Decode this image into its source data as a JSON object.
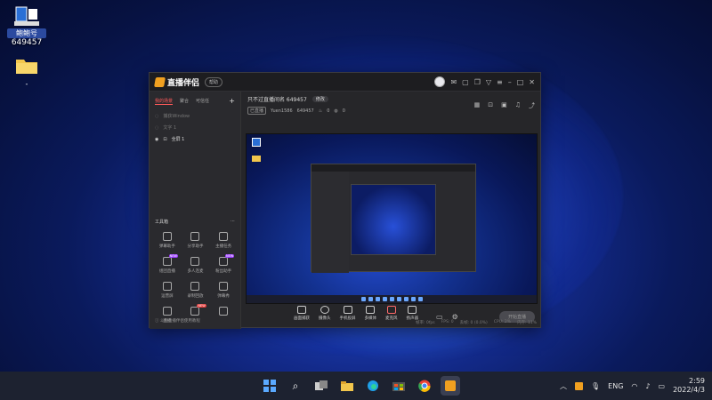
{
  "desktop": {
    "icons": [
      {
        "label": "鲍鲍号",
        "sub": "649457",
        "icon": "app-shortcut-icon"
      },
      {
        "label": "-",
        "icon": "folder-icon"
      }
    ]
  },
  "app": {
    "name": "直播伴侣",
    "version_pill": "帮助",
    "left_tabs": [
      "我的场景",
      "聚合",
      "可信任"
    ],
    "scenes": [
      {
        "label": "捕获Window",
        "on": false
      },
      {
        "label": "文字 1",
        "on": false
      },
      {
        "label": "全屏 1",
        "on": true
      }
    ],
    "tools_title": "工具箱",
    "tools": [
      {
        "label": "弹幕助手"
      },
      {
        "label": "分享助手"
      },
      {
        "label": "主播任务"
      },
      {
        "label": "组团直播",
        "badge": "NEW"
      },
      {
        "label": "多人连麦"
      },
      {
        "label": "粉丝助手",
        "badge": "NEW"
      },
      {
        "label": "运营屏"
      },
      {
        "label": "录制回放"
      },
      {
        "label": "弹幕秀"
      },
      {
        "label": "直播"
      },
      {
        "label": "",
        "badge": "NEW"
      },
      {
        "label": ""
      }
    ],
    "tip": "斗鱼直播伴侣使用教程",
    "room_title": "只不过直播间名 649457",
    "room_btn": "修改",
    "meta": [
      "已直播",
      "Yuen1586",
      "649457",
      "0",
      "0"
    ],
    "actions": [
      "画面捕获",
      "摄像头",
      "手机投屏",
      "多媒体",
      "麦克风",
      "扬声器"
    ],
    "golive": "开始直播",
    "status": [
      "帧率: 0fps",
      "FPS: 0",
      "丢帧: 0 (0.0%)",
      "CPU: 2%",
      "内存: 11%"
    ]
  },
  "taskbar": {
    "lang": "ENG",
    "time": "2:59",
    "date": "2022/4/3"
  }
}
